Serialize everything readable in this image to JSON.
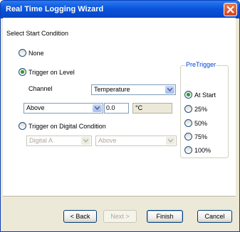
{
  "window": {
    "title": "Real Time Logging Wizard"
  },
  "heading": "Select Start Condition",
  "options": {
    "none": "None",
    "trigger_level": "Trigger on Level",
    "trigger_digital": "Trigger on Digital Condition"
  },
  "level": {
    "channel_label": "Channel",
    "channel_value": "Temperature",
    "condition_value": "Above",
    "threshold_value": "0.0",
    "unit": "°C"
  },
  "digital": {
    "channel_value": "Digital A",
    "condition_value": "Above"
  },
  "pretrigger": {
    "title": "PreTrigger",
    "items": [
      "At Start",
      "25%",
      "50%",
      "75%",
      "100%"
    ],
    "selected": "At Start"
  },
  "buttons": {
    "back": "< Back",
    "next": "Next >",
    "finish": "Finish",
    "cancel": "Cancel"
  },
  "colors": {
    "titlebar": "#0a54dc",
    "close": "#d2431c",
    "group_title": "#0046d5"
  }
}
